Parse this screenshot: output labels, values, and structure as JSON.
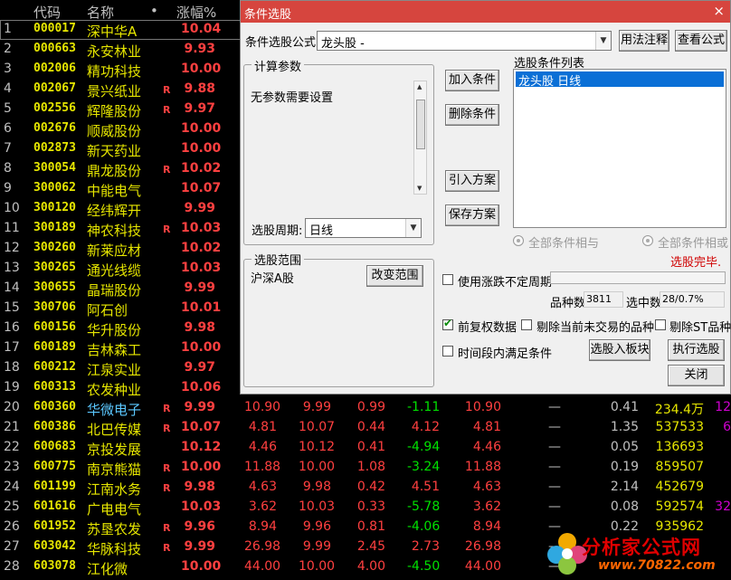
{
  "header": {
    "idx": "",
    "code": "代码",
    "name": "名称",
    "dot": "•",
    "pct": "涨幅%"
  },
  "rows": [
    {
      "idx": "1",
      "code": "000017",
      "name": "深中华A",
      "flag": "",
      "pct": "10.04",
      "cols": []
    },
    {
      "idx": "2",
      "code": "000663",
      "name": "永安林业",
      "flag": "",
      "pct": "9.93",
      "cols": []
    },
    {
      "idx": "3",
      "code": "002006",
      "name": "精功科技",
      "flag": "",
      "pct": "10.00",
      "cols": []
    },
    {
      "idx": "4",
      "code": "002067",
      "name": "景兴纸业",
      "flag": "R",
      "pct": "9.88",
      "cols": []
    },
    {
      "idx": "5",
      "code": "002556",
      "name": "辉隆股份",
      "flag": "R",
      "pct": "9.97",
      "cols": []
    },
    {
      "idx": "6",
      "code": "002676",
      "name": "顺威股份",
      "flag": "",
      "pct": "10.00",
      "cols": []
    },
    {
      "idx": "7",
      "code": "002873",
      "name": "新天药业",
      "flag": "",
      "pct": "10.00",
      "cols": []
    },
    {
      "idx": "8",
      "code": "300054",
      "name": "鼎龙股份",
      "flag": "R",
      "pct": "10.02",
      "cols": []
    },
    {
      "idx": "9",
      "code": "300062",
      "name": "中能电气",
      "flag": "",
      "pct": "10.07",
      "cols": []
    },
    {
      "idx": "10",
      "code": "300120",
      "name": "经纬辉开",
      "flag": "",
      "pct": "9.99",
      "cols": []
    },
    {
      "idx": "11",
      "code": "300189",
      "name": "神农科技",
      "flag": "R",
      "pct": "10.03",
      "cols": []
    },
    {
      "idx": "12",
      "code": "300260",
      "name": "新莱应材",
      "flag": "",
      "pct": "10.02",
      "cols": []
    },
    {
      "idx": "13",
      "code": "300265",
      "name": "通光线缆",
      "flag": "",
      "pct": "10.03",
      "cols": []
    },
    {
      "idx": "14",
      "code": "300655",
      "name": "晶瑞股份",
      "flag": "",
      "pct": "9.99",
      "cols": []
    },
    {
      "idx": "15",
      "code": "300706",
      "name": "阿石创",
      "flag": "",
      "pct": "10.01",
      "cols": []
    },
    {
      "idx": "16",
      "code": "600156",
      "name": "华升股份",
      "flag": "",
      "pct": "9.98",
      "cols": []
    },
    {
      "idx": "17",
      "code": "600189",
      "name": "吉林森工",
      "flag": "",
      "pct": "10.00",
      "cols": []
    },
    {
      "idx": "18",
      "code": "600212",
      "name": "江泉实业",
      "flag": "",
      "pct": "9.97",
      "cols": []
    },
    {
      "idx": "19",
      "code": "600313",
      "name": "农发种业",
      "flag": "",
      "pct": "10.06",
      "cols": []
    },
    {
      "idx": "20",
      "code": "600360",
      "name": "华微电子",
      "flag": "R",
      "pct": "9.99",
      "cols": [
        "10.90",
        "9.99",
        "0.99",
        "-1.11",
        "10.90",
        "—",
        "0.41",
        "234.4万",
        "12"
      ]
    },
    {
      "idx": "21",
      "code": "600386",
      "name": "北巴传媒",
      "flag": "R",
      "pct": "10.07",
      "cols": [
        "4.81",
        "10.07",
        "0.44",
        "4.12",
        "4.81",
        "—",
        "1.35",
        "537533",
        "6"
      ]
    },
    {
      "idx": "22",
      "code": "600683",
      "name": "京投发展",
      "flag": "",
      "pct": "10.12",
      "cols": [
        "4.46",
        "10.12",
        "0.41",
        "-4.94",
        "4.46",
        "—",
        "0.05",
        "136693",
        ""
      ]
    },
    {
      "idx": "23",
      "code": "600775",
      "name": "南京熊猫",
      "flag": "R",
      "pct": "10.00",
      "cols": [
        "11.88",
        "10.00",
        "1.08",
        "-3.24",
        "11.88",
        "—",
        "0.19",
        "859507",
        ""
      ]
    },
    {
      "idx": "24",
      "code": "601199",
      "name": "江南水务",
      "flag": "R",
      "pct": "9.98",
      "cols": [
        "4.63",
        "9.98",
        "0.42",
        "4.51",
        "4.63",
        "—",
        "2.14",
        "452679",
        ""
      ]
    },
    {
      "idx": "25",
      "code": "601616",
      "name": "广电电气",
      "flag": "",
      "pct": "10.03",
      "cols": [
        "3.62",
        "10.03",
        "0.33",
        "-5.78",
        "3.62",
        "—",
        "0.08",
        "592574",
        "32"
      ]
    },
    {
      "idx": "26",
      "code": "601952",
      "name": "苏垦农发",
      "flag": "R",
      "pct": "9.96",
      "cols": [
        "8.94",
        "9.96",
        "0.81",
        "-4.06",
        "8.94",
        "—",
        "0.22",
        "935962",
        ""
      ]
    },
    {
      "idx": "27",
      "code": "603042",
      "name": "华脉科技",
      "flag": "R",
      "pct": "9.99",
      "cols": [
        "26.98",
        "9.99",
        "2.45",
        "2.73",
        "26.98",
        "—",
        "",
        "",
        ""
      ]
    },
    {
      "idx": "28",
      "code": "603078",
      "name": "江化微",
      "flag": "",
      "pct": "10.00",
      "cols": [
        "44.00",
        "10.00",
        "4.00",
        "-4.50",
        "44.00",
        "—",
        "",
        "",
        ""
      ]
    }
  ],
  "dialog": {
    "title": "条件选股",
    "close": "×",
    "formula_label": "条件选股公式",
    "formula_value": "龙头股           -",
    "usage_btn": "用法注释",
    "view_formula_btn": "查看公式",
    "params_group": "计算参数",
    "params_text": "无参数需要设置",
    "period_label": "选股周期:",
    "period_value": "日线",
    "add_btn": "加入条件",
    "delete_btn": "删除条件",
    "import_btn": "引入方案",
    "save_btn": "保存方案",
    "list_label": "选股条件列表",
    "list_items": [
      "龙头股   日线"
    ],
    "radio_and": "全部条件相与",
    "radio_or": "全部条件相或",
    "status": "选股完毕.",
    "range_group": "选股范围",
    "range_value": "沪深A股",
    "change_range_btn": "改变范围",
    "chk_variable_period": "使用涨跌不定周期",
    "count_label": "品种数",
    "count_value": "3811",
    "selected_label": "选中数",
    "selected_value": "28/0.7%",
    "chk_adjusted": "前复权数据",
    "chk_exclude_untraded": "剔除当前未交易的品种",
    "chk_exclude_st": "剔除ST品种",
    "chk_time_range": "时间段内满足条件",
    "to_block_btn": "选股入板块",
    "execute_btn": "执行选股",
    "close_btn": "关闭"
  },
  "watermark": {
    "brand": "分析家公式网",
    "url": "www.70822.com"
  }
}
